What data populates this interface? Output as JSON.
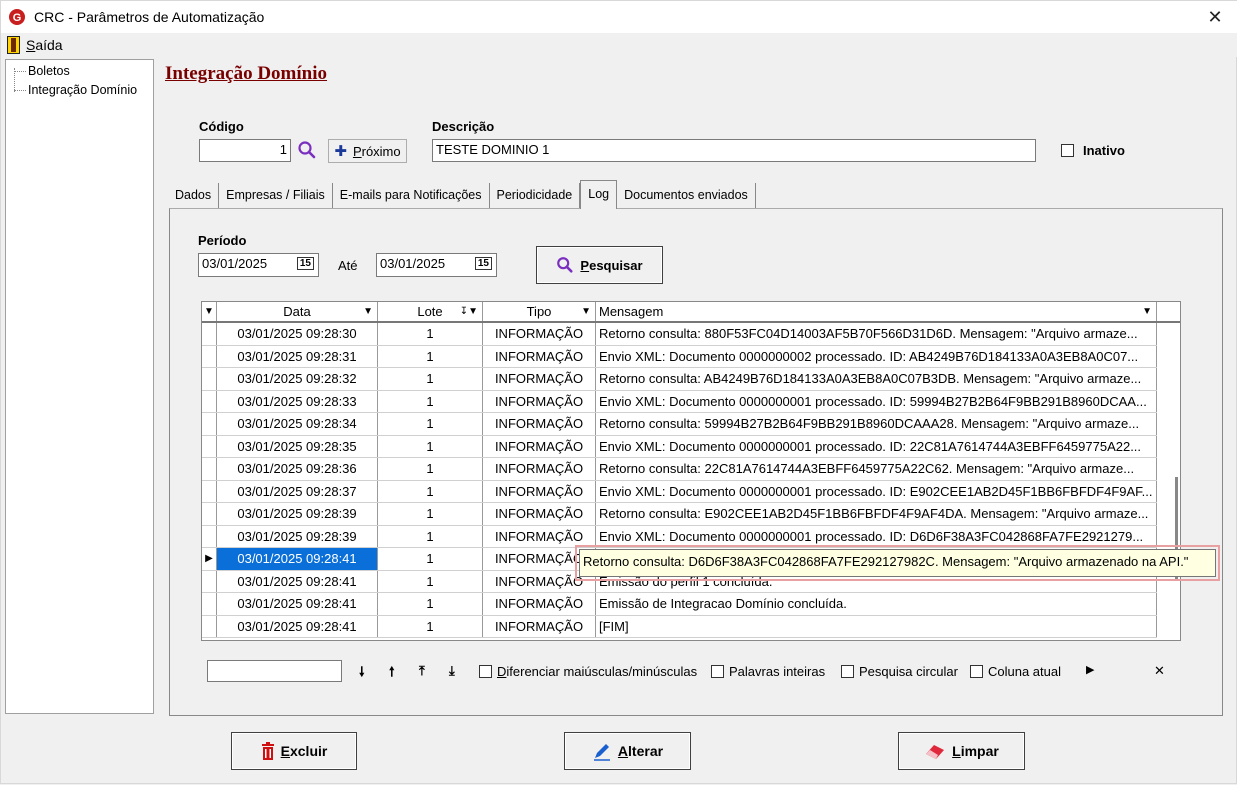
{
  "window": {
    "title": "CRC - Parâmetros de Automatização",
    "close": "✕"
  },
  "menu": {
    "exit": "Saída"
  },
  "tree": {
    "items": [
      {
        "label": "Boletos"
      },
      {
        "label": "Integração Domínio"
      }
    ]
  },
  "page": {
    "title": "Integração Domínio",
    "codigo_label": "Código",
    "codigo_value": "1",
    "proximo_label": "Próximo",
    "descricao_label": "Descrição",
    "descricao_value": "TESTE DOMINIO 1",
    "inativo_label": "Inativo"
  },
  "tabs": [
    {
      "label": "Dados"
    },
    {
      "label": "Empresas / Filiais"
    },
    {
      "label": "E-mails para Notificações"
    },
    {
      "label": "Periodicidade"
    },
    {
      "label": "Log"
    },
    {
      "label": "Documentos enviados"
    }
  ],
  "log": {
    "periodo_label": "Período",
    "date_from": "03/01/2025",
    "ate_label": "Até",
    "date_to": "03/01/2025",
    "calendar_glyph": "15",
    "search_button": "Pesquisar",
    "columns": [
      "Data",
      "Lote",
      "Tipo",
      "Mensagem"
    ],
    "rows": [
      {
        "data": "03/01/2025 09:28:30",
        "lote": "1",
        "tipo": "INFORMAÇÃO",
        "mensagem": "Retorno consulta: 880F53FC04D14003AF5B70F566D31D6D. Mensagem: \"Arquivo armaze..."
      },
      {
        "data": "03/01/2025 09:28:31",
        "lote": "1",
        "tipo": "INFORMAÇÃO",
        "mensagem": "Envio XML: Documento 0000000002 processado. ID: AB4249B76D184133A0A3EB8A0C07..."
      },
      {
        "data": "03/01/2025 09:28:32",
        "lote": "1",
        "tipo": "INFORMAÇÃO",
        "mensagem": "Retorno consulta: AB4249B76D184133A0A3EB8A0C07B3DB. Mensagem: \"Arquivo armaze..."
      },
      {
        "data": "03/01/2025 09:28:33",
        "lote": "1",
        "tipo": "INFORMAÇÃO",
        "mensagem": "Envio XML: Documento 0000000001 processado. ID: 59994B27B2B64F9BB291B8960DCAA..."
      },
      {
        "data": "03/01/2025 09:28:34",
        "lote": "1",
        "tipo": "INFORMAÇÃO",
        "mensagem": "Retorno consulta: 59994B27B2B64F9BB291B8960DCAAA28. Mensagem: \"Arquivo armaze..."
      },
      {
        "data": "03/01/2025 09:28:35",
        "lote": "1",
        "tipo": "INFORMAÇÃO",
        "mensagem": "Envio XML: Documento 0000000001 processado. ID: 22C81A7614744A3EBFF6459775A22..."
      },
      {
        "data": "03/01/2025 09:28:36",
        "lote": "1",
        "tipo": "INFORMAÇÃO",
        "mensagem": "Retorno consulta: 22C81A7614744A3EBFF6459775A22C62. Mensagem: \"Arquivo armaze..."
      },
      {
        "data": "03/01/2025 09:28:37",
        "lote": "1",
        "tipo": "INFORMAÇÃO",
        "mensagem": "Envio XML: Documento 0000000001 processado. ID: E902CEE1AB2D45F1BB6FBFDF4F9AF..."
      },
      {
        "data": "03/01/2025 09:28:39",
        "lote": "1",
        "tipo": "INFORMAÇÃO",
        "mensagem": "Retorno consulta: E902CEE1AB2D45F1BB6FBFDF4F9AF4DA. Mensagem: \"Arquivo armaze..."
      },
      {
        "data": "03/01/2025 09:28:39",
        "lote": "1",
        "tipo": "INFORMAÇÃO",
        "mensagem": "Envio XML: Documento 0000000001 processado. ID: D6D6F38A3FC042868FA7FE2921279..."
      },
      {
        "data": "03/01/2025 09:28:41",
        "lote": "1",
        "tipo": "INFORMAÇÃO",
        "mensagem": "Retorno consulta: D6D6F38A3FC042868FA7FE292127982C. Mensagem: \"Arquivo armazenado na API.\""
      },
      {
        "data": "03/01/2025 09:28:41",
        "lote": "1",
        "tipo": "INFORMAÇÃO",
        "mensagem": "Emissão do perfil 1 concluída."
      },
      {
        "data": "03/01/2025 09:28:41",
        "lote": "1",
        "tipo": "INFORMAÇÃO",
        "mensagem": "Emissão de Integracao Domínio concluída."
      },
      {
        "data": "03/01/2025 09:28:41",
        "lote": "1",
        "tipo": "INFORMAÇÃO",
        "mensagem": "[FIM]"
      }
    ],
    "tooltip": "Retorno consulta: D6D6F38A3FC042868FA7FE292127982C. Mensagem: \"Arquivo armazenado na API.\"",
    "search_options": {
      "case": "Diferenciar maiúsculas/minúsculas",
      "whole": "Palavras inteiras",
      "circular": "Pesquisa circular",
      "column": "Coluna atual"
    }
  },
  "actions": {
    "excluir": "Excluir",
    "alterar": "Alterar",
    "limpar": "Limpar"
  },
  "colors": {
    "title": "#7a0000",
    "selection": "#0a6fd8",
    "search_icon": "#7b2fbf",
    "delete_icon": "#d01010",
    "edit_icon": "#1a5fd0"
  }
}
